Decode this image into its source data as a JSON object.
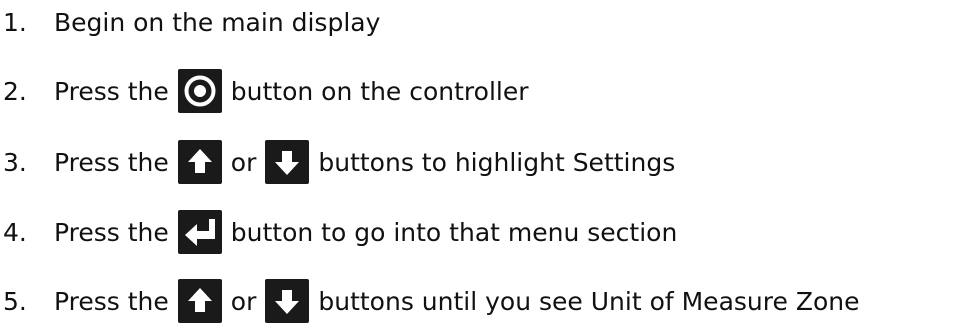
{
  "steps": [
    {
      "number": "1.",
      "parts": [
        "Begin on the main display"
      ]
    },
    {
      "number": "2.",
      "parts": [
        "Press the",
        "button on the controller"
      ],
      "icons": [
        "target-button-icon"
      ]
    },
    {
      "number": "3.",
      "parts": [
        "Press the",
        "or",
        "buttons to highlight Settings"
      ],
      "icons": [
        "up-arrow-icon",
        "down-arrow-icon"
      ]
    },
    {
      "number": "4.",
      "parts": [
        "Press the",
        "button to go into that menu section"
      ],
      "icons": [
        "enter-return-icon"
      ]
    },
    {
      "number": "5.",
      "parts": [
        "Press the",
        "or",
        "buttons until you see Unit of Measure Zone"
      ],
      "icons": [
        "up-arrow-icon",
        "down-arrow-icon"
      ]
    }
  ],
  "colors": {
    "text": "#111111",
    "icon_bg": "#1a1a1a",
    "icon_fg": "#ffffff"
  }
}
